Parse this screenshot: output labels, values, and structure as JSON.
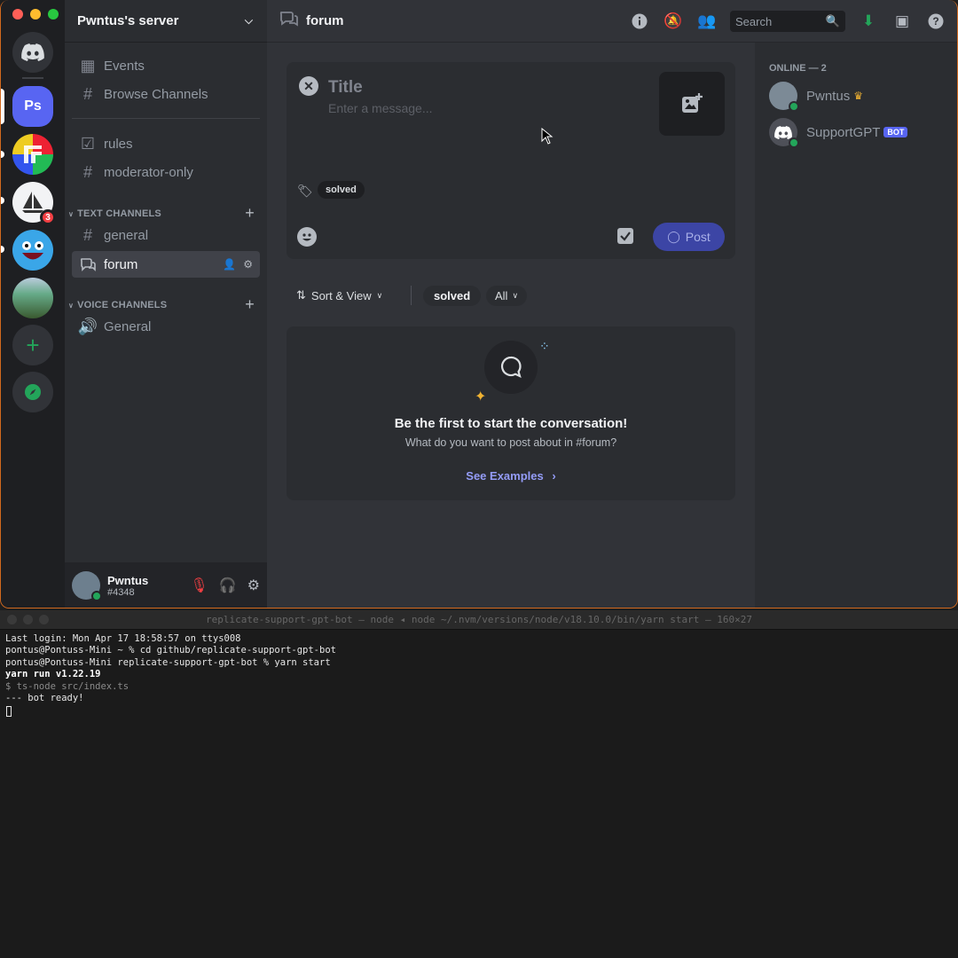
{
  "server": {
    "name": "Pwntus's server",
    "guild_initials": "Ps",
    "unread_count": "3",
    "nav": [
      {
        "label": "Events",
        "icon": "calendar-icon"
      },
      {
        "label": "Browse Channels",
        "icon": "hash-search-icon"
      }
    ],
    "channels_top": [
      {
        "label": "rules",
        "icon": "rules-icon"
      },
      {
        "label": "moderator-only",
        "icon": "hash-lock-icon"
      }
    ],
    "text_category": "TEXT CHANNELS",
    "text_channels": [
      {
        "label": "general",
        "icon": "hash-icon"
      },
      {
        "label": "forum",
        "icon": "forum-icon",
        "active": true
      }
    ],
    "voice_category": "VOICE CHANNELS",
    "voice_channels": [
      {
        "label": "General",
        "icon": "speaker-icon"
      }
    ]
  },
  "user": {
    "name": "Pwntus",
    "tag": "#4348"
  },
  "channel": {
    "name": "forum"
  },
  "search": {
    "placeholder": "Search"
  },
  "composer": {
    "title_placeholder": "Title",
    "message_placeholder": "Enter a message...",
    "tag": "solved",
    "post_label": "Post"
  },
  "filters": {
    "sort_label": "Sort & View",
    "tag": "solved",
    "all_label": "All"
  },
  "empty": {
    "heading": "Be the first to start the conversation!",
    "sub": "What do you want to post about in #forum?",
    "link": "See Examples"
  },
  "members": {
    "header": "ONLINE — 2",
    "list": [
      {
        "name": "Pwntus",
        "crown": true
      },
      {
        "name": "SupportGPT",
        "bot_tag": "BOT"
      }
    ]
  },
  "terminal": {
    "title": "replicate-support-gpt-bot — node ◂ node ~/.nvm/versions/node/v18.10.0/bin/yarn start — 160×27",
    "lines": [
      {
        "text": "Last login: Mon Apr 17 18:58:57 on ttys008",
        "style": ""
      },
      {
        "text": "pontus@Pontuss-Mini ~ % cd github/replicate-support-gpt-bot",
        "style": ""
      },
      {
        "text": "pontus@Pontuss-Mini replicate-support-gpt-bot % yarn start",
        "style": ""
      },
      {
        "text": "yarn run v1.22.19",
        "style": "bold"
      },
      {
        "text": "$ ts-node src/index.ts",
        "style": "dim"
      },
      {
        "text": "--- bot ready!",
        "style": ""
      }
    ]
  },
  "colors": {
    "accent": "#5865f2",
    "online": "#23a55a",
    "danger": "#f23f43"
  }
}
